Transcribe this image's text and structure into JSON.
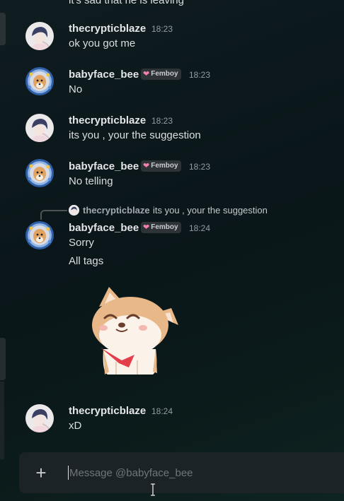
{
  "messages": [
    {
      "partial_text": "it's sad that he is leaving"
    },
    {
      "username": "thecrypticblaze",
      "time": "18:23",
      "text": "ok you got me"
    },
    {
      "username": "babyface_bee",
      "tag": "Femboy",
      "time": "18:23",
      "text": "No"
    },
    {
      "username": "thecrypticblaze",
      "time": "18:23",
      "text": "its you , your the suggestion"
    },
    {
      "username": "babyface_bee",
      "tag": "Femboy",
      "time": "18:23",
      "text": "No telling"
    },
    {
      "reply": {
        "username": "thecrypticblaze",
        "text": "its you , your the suggestion"
      },
      "username": "babyface_bee",
      "tag": "Femboy",
      "time": "18:24",
      "lines": [
        "Sorry",
        "All tags"
      ],
      "sticker": "shiba-inu-sticker"
    },
    {
      "username": "thecrypticblaze",
      "time": "18:24",
      "text": "xD"
    }
  ],
  "composer": {
    "placeholder": "Message @babyface_bee",
    "add_icon": "plus-icon"
  },
  "colors": {
    "tag_heart": "#f47fb0",
    "username": "#e3e5e8",
    "timestamp": "#949ba4",
    "text": "#dbdee1"
  }
}
